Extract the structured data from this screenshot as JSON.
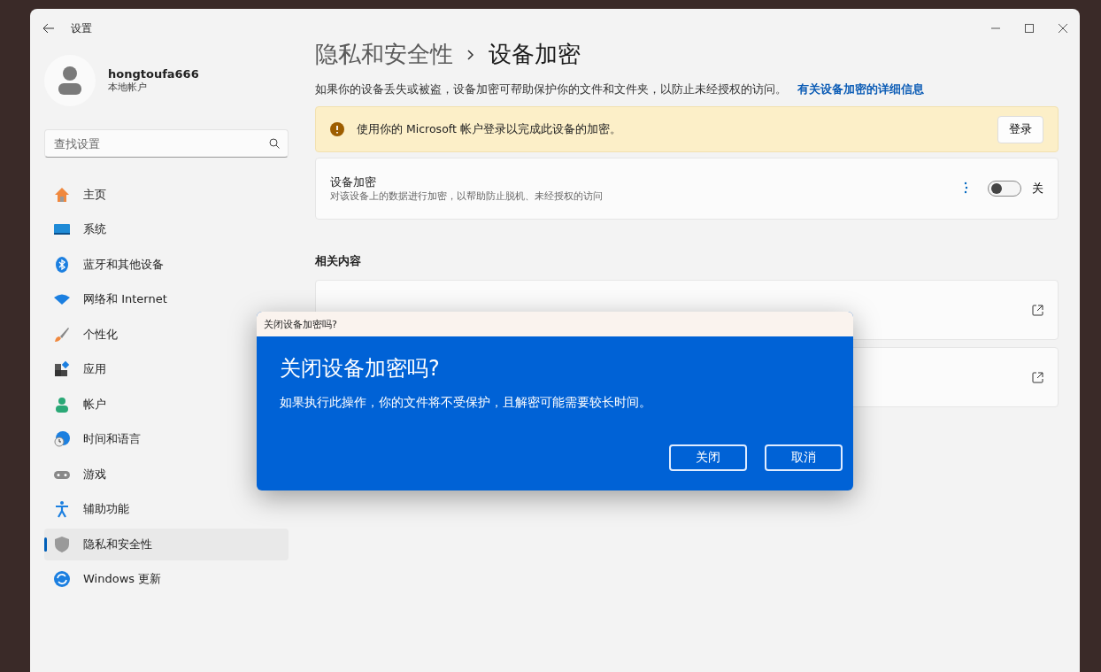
{
  "window": {
    "title": "设置"
  },
  "account": {
    "name": "hongtoufa666",
    "type": "本地帐户"
  },
  "search": {
    "placeholder": "查找设置"
  },
  "sidebar": {
    "items": [
      {
        "label": "主页",
        "kind": "home",
        "selected": false
      },
      {
        "label": "系统",
        "kind": "system",
        "selected": false
      },
      {
        "label": "蓝牙和其他设备",
        "kind": "bluetooth",
        "selected": false
      },
      {
        "label": "网络和 Internet",
        "kind": "network",
        "selected": false
      },
      {
        "label": "个性化",
        "kind": "brush",
        "selected": false
      },
      {
        "label": "应用",
        "kind": "apps",
        "selected": false
      },
      {
        "label": "帐户",
        "kind": "account",
        "selected": false
      },
      {
        "label": "时间和语言",
        "kind": "time",
        "selected": false
      },
      {
        "label": "游戏",
        "kind": "game",
        "selected": false
      },
      {
        "label": "辅助功能",
        "kind": "access",
        "selected": false
      },
      {
        "label": "隐私和安全性",
        "kind": "shield",
        "selected": true
      },
      {
        "label": "Windows 更新",
        "kind": "update",
        "selected": false
      }
    ]
  },
  "breadcrumb": [
    "隐私和安全性",
    "设备加密"
  ],
  "description": "如果你的设备丢失或被盗，设备加密可帮助保护你的文件和文件夹，以防止未经授权的访问。",
  "description_link": "有关设备加密的详细信息",
  "warning": {
    "text": "使用你的 Microsoft 帐户登录以完成此设备的加密。",
    "button": "登录"
  },
  "encryption": {
    "title": "设备加密",
    "subtitle": "对该设备上的数据进行加密，以帮助防止脱机、未经授权的访问",
    "on": false,
    "state_label": "关"
  },
  "related": {
    "title": "相关内容",
    "cards": [
      {
        "kind": "external"
      },
      {
        "kind": "external"
      }
    ]
  },
  "dialog": {
    "caption": "关闭设备加密吗?",
    "title": "关闭设备加密吗?",
    "message": "如果执行此操作，你的文件将不受保护，且解密可能需要较长时间。",
    "buttons": [
      "关闭",
      "取消"
    ]
  }
}
